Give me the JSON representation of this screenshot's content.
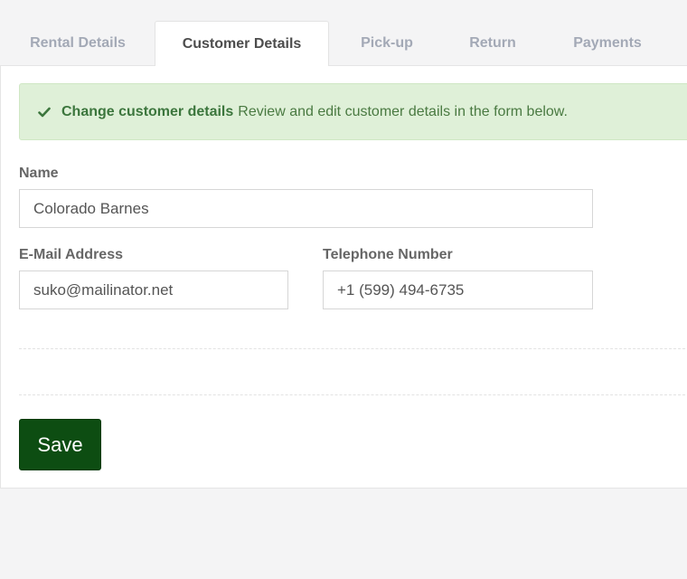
{
  "tabs": [
    {
      "label": "Rental Details",
      "active": false
    },
    {
      "label": "Customer Details",
      "active": true
    },
    {
      "label": "Pick-up",
      "active": false
    },
    {
      "label": "Return",
      "active": false
    },
    {
      "label": "Payments",
      "active": false
    }
  ],
  "alert": {
    "title": "Change customer details",
    "message": "Review and edit customer details in the form below.",
    "icon": "check-icon",
    "color": "#dff0d8"
  },
  "form": {
    "name_label": "Name",
    "name_value": "Colorado Barnes",
    "email_label": "E-Mail Address",
    "email_value": "suko@mailinator.net",
    "phone_label": "Telephone Number",
    "phone_value": "+1 (599) 494-6735"
  },
  "actions": {
    "save_label": "Save",
    "save_color": "#0d4d12"
  }
}
